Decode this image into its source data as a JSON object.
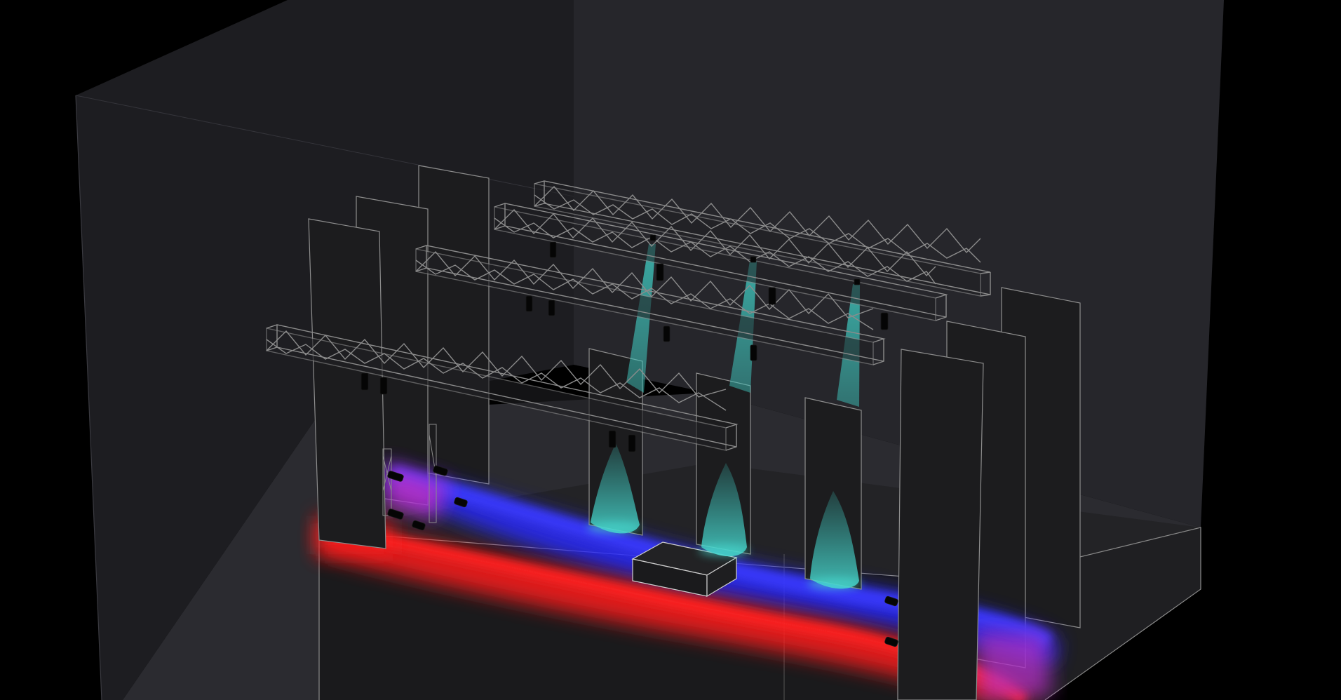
{
  "scene": {
    "kind": "3d-stage-lighting-render",
    "colors": {
      "background": "#000000",
      "left_wall": "#1d1d21",
      "back_wall": "#26262b",
      "floor": "#2b2b30",
      "stage": "#1a1a1c",
      "flat": "#1c1c1e",
      "outline": "#9a9a9a",
      "truss": "#8c8c8c",
      "fixture": "#050505",
      "beam_cyan": "#3fc9c0",
      "wash_blue": "#2a2aff",
      "wash_red": "#ff1a1a",
      "wash_magenta": "#c832c8"
    },
    "counts": {
      "trusses": 4,
      "scenery_flats": 10,
      "spot_beams": 3
    }
  }
}
